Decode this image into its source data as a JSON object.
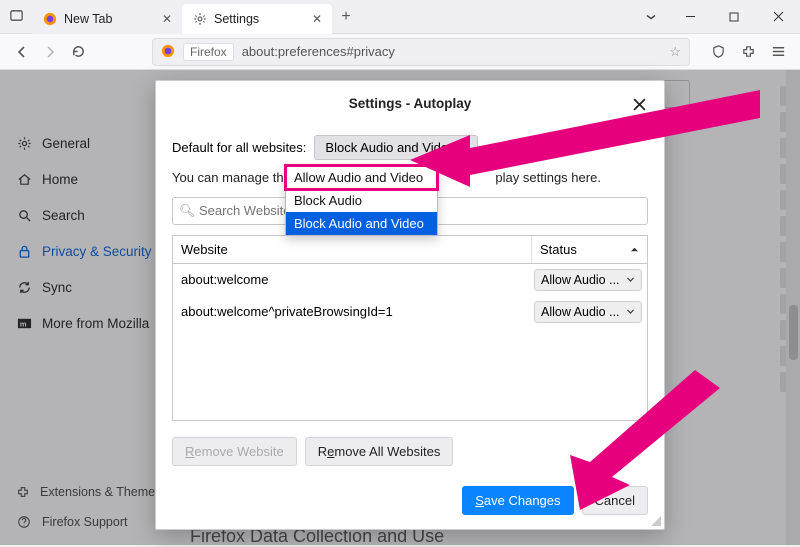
{
  "tabs": {
    "tab1": {
      "label": "New Tab"
    },
    "tab2": {
      "label": "Settings"
    }
  },
  "url": {
    "badge": "Firefox",
    "address": "about:preferences#privacy"
  },
  "sidebar": {
    "items": {
      "general": "General",
      "home": "Home",
      "search": "Search",
      "privacy": "Privacy & Security",
      "sync": "Sync",
      "more": "More from Mozilla"
    },
    "bottom": {
      "ext": "Extensions & Themes",
      "support": "Firefox Support"
    }
  },
  "bg": {
    "section_title": "Firefox Data Collection and Use"
  },
  "modal": {
    "title": "Settings - Autoplay",
    "default_label": "Default for all websites:",
    "default_value": "Block Audio and Video",
    "desc_prefix": "You can manage the site",
    "desc_suffix": "play settings here.",
    "search_placeholder": "Search Website",
    "th_website": "Website",
    "th_status": "Status",
    "rows": [
      {
        "site": "about:welcome",
        "status": "Allow Audio ..."
      },
      {
        "site": "about:welcome^privateBrowsingId=1",
        "status": "Allow Audio ..."
      }
    ],
    "remove": "Remove Website",
    "remove_all": "Remove All Websites",
    "save": "Save Changes",
    "cancel": "Cancel"
  },
  "dropdown": {
    "opt1": "Allow Audio and Video",
    "opt2": "Block Audio",
    "opt3": "Block Audio and Video"
  }
}
